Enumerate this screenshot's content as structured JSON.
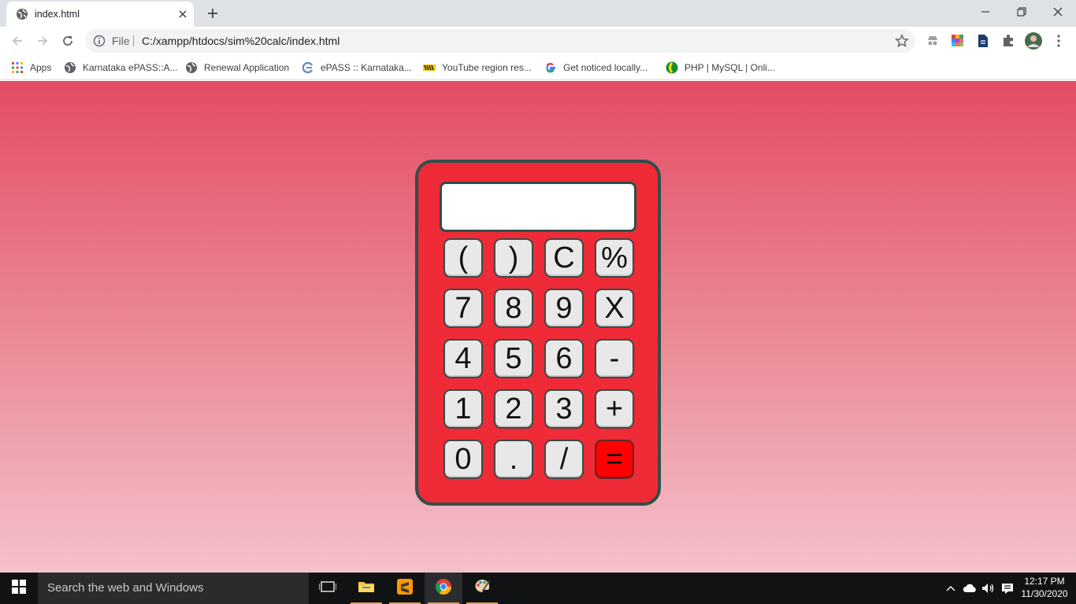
{
  "tab": {
    "title": "index.html"
  },
  "toolbar": {
    "scheme_label": "File",
    "url": "C:/xampp/htdocs/sim%20calc/index.html"
  },
  "bookmarks": [
    {
      "label": "Apps",
      "icon": "apps-grid-icon"
    },
    {
      "label": "Karnataka ePASS::A...",
      "icon": "globe-icon"
    },
    {
      "label": "Renewal Application",
      "icon": "globe-icon"
    },
    {
      "label": "ePASS :: Karnataka...",
      "icon": "epass-icon"
    },
    {
      "label": "YouTube region res...",
      "icon": "youtube-region-icon"
    },
    {
      "label": "Get noticed locally...",
      "icon": "google-icon"
    },
    {
      "label": "PHP | MySQL | Onli...",
      "icon": "php-icon"
    }
  ],
  "calculator": {
    "display_value": "",
    "keys": [
      [
        "(",
        ")",
        "C",
        "%"
      ],
      [
        "7",
        "8",
        "9",
        "X"
      ],
      [
        "4",
        "5",
        "6",
        "-"
      ],
      [
        "1",
        "2",
        "3",
        "+"
      ],
      [
        "0",
        ".",
        "/",
        "="
      ]
    ],
    "colors": {
      "body": "#ee2b36",
      "border": "#2f4f4b",
      "key": "#e8e8e8",
      "equals": "#ff0000"
    }
  },
  "taskbar": {
    "search_placeholder": "Search the web and Windows",
    "time": "12:17 PM",
    "date": "11/30/2020"
  }
}
